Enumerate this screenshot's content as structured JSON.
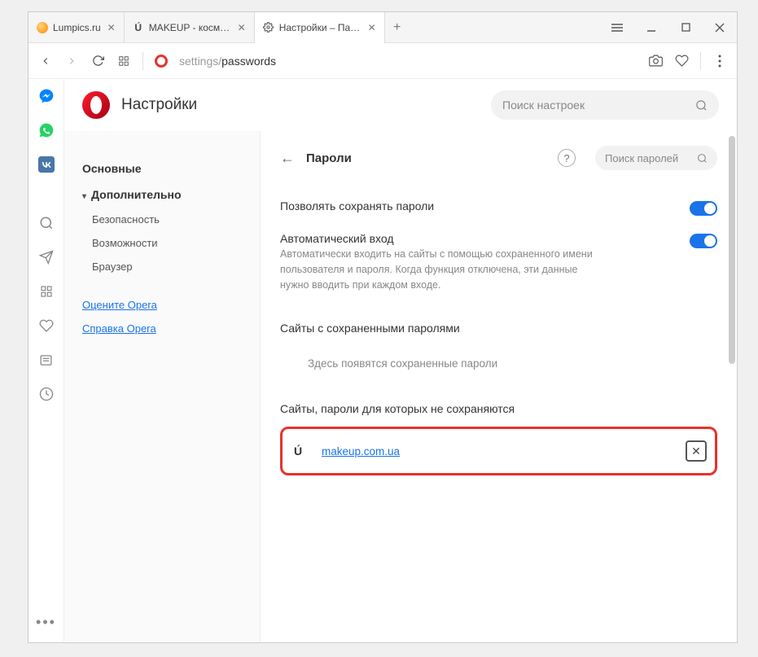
{
  "tabs": [
    {
      "title": "Lumpics.ru",
      "icon": "orange"
    },
    {
      "title": "MAKEUP - косметика и па",
      "icon": "u"
    },
    {
      "title": "Настройки – Пароли",
      "icon": "gear",
      "active": true
    }
  ],
  "url": {
    "prefix": "settings/",
    "path": "passwords"
  },
  "page_title": "Настройки",
  "search_settings_placeholder": "Поиск настроек",
  "nav": {
    "main": "Основные",
    "advanced": "Дополнительно",
    "security": "Безопасность",
    "features": "Возможности",
    "browser": "Браузер",
    "rate": "Оцените Opera",
    "help": "Справка Opera"
  },
  "sub": {
    "title": "Пароли",
    "search_placeholder": "Поиск паролей"
  },
  "settings": {
    "allow_save": "Позволять сохранять пароли",
    "auto_login_title": "Автоматический вход",
    "auto_login_desc": "Автоматически входить на сайты с помощью сохраненного имени пользователя и пароля. Когда функция отключена, эти данные нужно вводить при каждом входе."
  },
  "sections": {
    "saved_title": "Сайты с сохраненными паролями",
    "saved_empty": "Здесь появятся сохраненные пароли",
    "never_title": "Сайты, пароли для которых не сохраняются"
  },
  "never_sites": [
    {
      "icon": "Ú",
      "url": "makeup.com.ua"
    }
  ]
}
